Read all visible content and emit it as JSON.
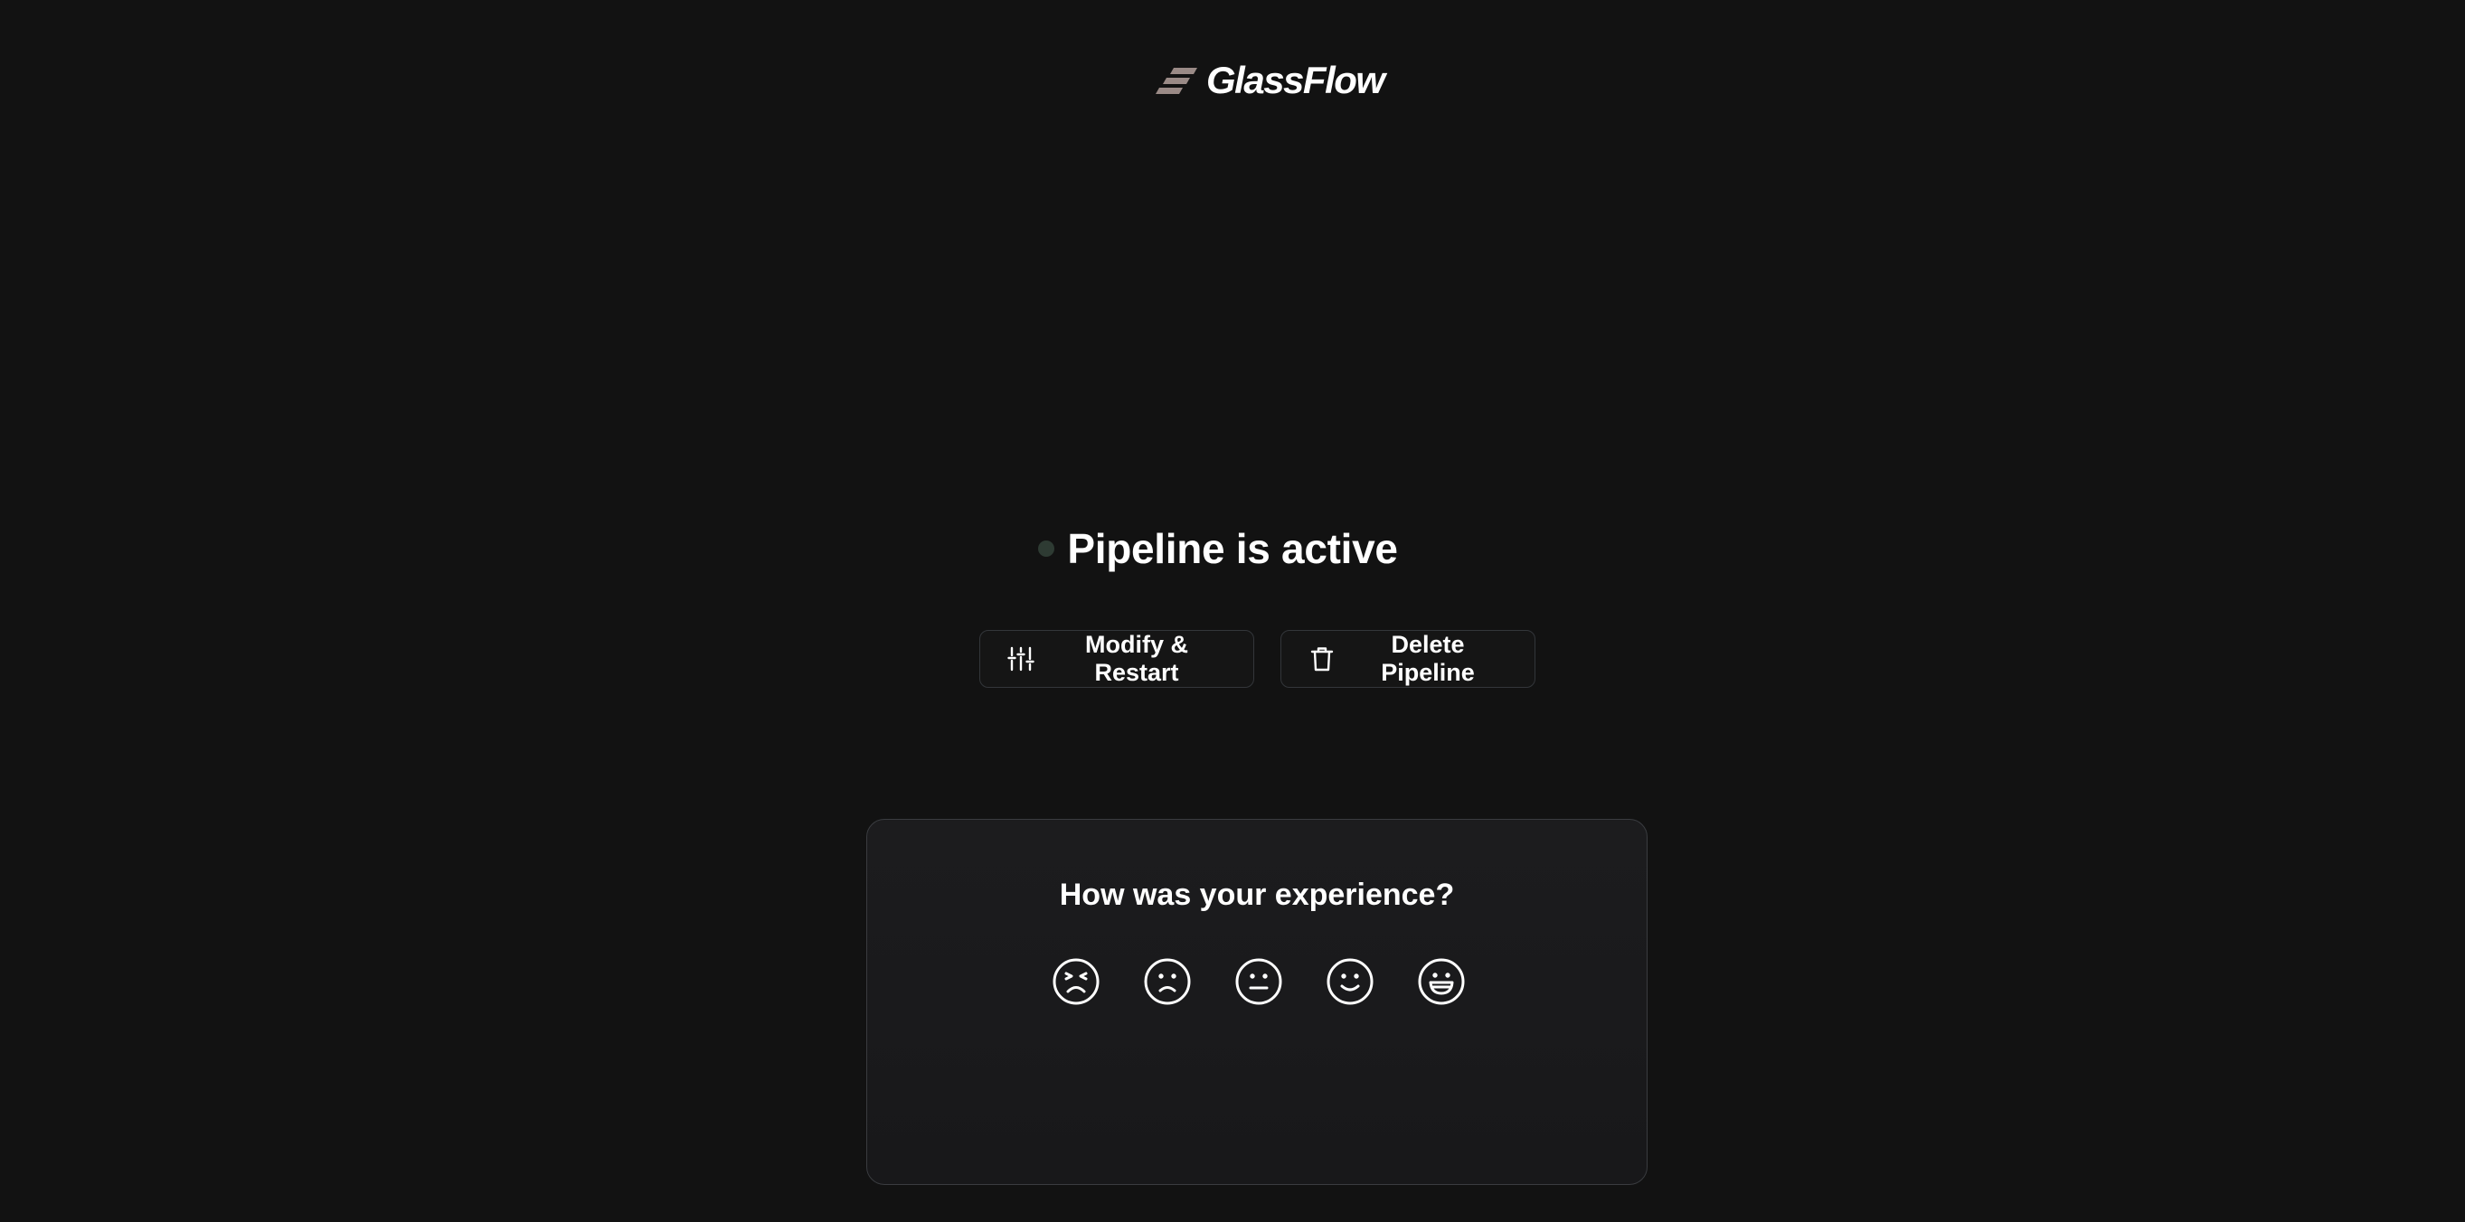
{
  "brand": {
    "name": "GlassFlow",
    "mark_color": "#9a8a86"
  },
  "status": {
    "title": "Pipeline is active",
    "indicator_color": "#2e3b33"
  },
  "actions": {
    "modify_label": "Modify & Restart",
    "modify_icon": "sliders-icon",
    "delete_label": "Delete Pipeline",
    "delete_icon": "trash-icon"
  },
  "feedback": {
    "question": "How was your experience?",
    "options": [
      {
        "icon": "very-unhappy-face-icon"
      },
      {
        "icon": "unhappy-face-icon"
      },
      {
        "icon": "neutral-face-icon"
      },
      {
        "icon": "happy-face-icon"
      },
      {
        "icon": "very-happy-face-icon"
      }
    ]
  }
}
